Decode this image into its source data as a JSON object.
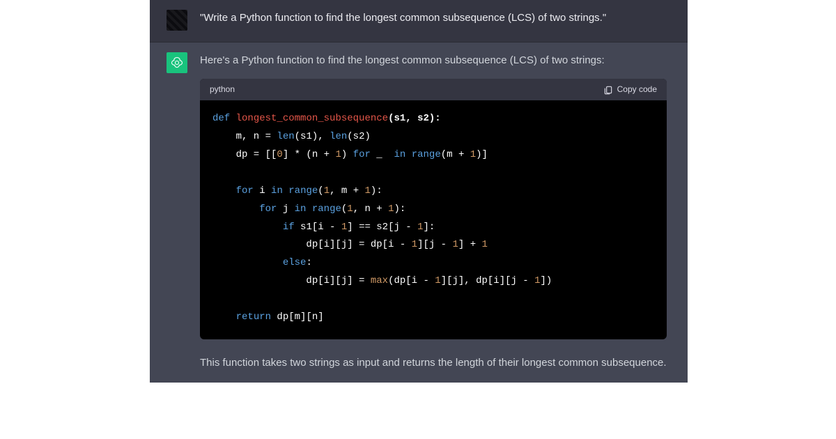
{
  "user_message": "\"Write a Python function to find the longest common subsequence (LCS) of two strings.\"",
  "assistant_intro": "Here's a Python function to find the longest common subsequence (LCS) of two strings:",
  "code_language": "python",
  "copy_label": "Copy code",
  "code_tokens": {
    "l1_def": "def",
    "l1_fn": "longest_common_subsequence",
    "l1_args": "(s1, s2):",
    "l2_a": "    m, n = ",
    "l2_len1": "len",
    "l2_b": "(s1), ",
    "l2_len2": "len",
    "l2_c": "(s2)",
    "l3_a": "    dp = [[",
    "l3_zero": "0",
    "l3_b": "] * (n + ",
    "l3_one": "1",
    "l3_c": ") ",
    "l3_for": "for",
    "l3_d": " _ ",
    "l3_in": " in ",
    "l3_range": "range",
    "l3_e": "(m + ",
    "l3_one2": "1",
    "l3_f": ")]",
    "l5_for": "for",
    "l5_a": " i ",
    "l5_in": "in",
    "l5_b": " ",
    "l5_range": "range",
    "l5_c": "(",
    "l5_one": "1",
    "l5_d": ", m + ",
    "l5_one2": "1",
    "l5_e": "):",
    "l6_for": "for",
    "l6_a": " j ",
    "l6_in": "in",
    "l6_b": " ",
    "l6_range": "range",
    "l6_c": "(",
    "l6_one": "1",
    "l6_d": ", n + ",
    "l6_one2": "1",
    "l6_e": "):",
    "l7_if": "if",
    "l7_a": " s1[i - ",
    "l7_one": "1",
    "l7_b": "] == s2[j - ",
    "l7_one2": "1",
    "l7_c": "]:",
    "l8_a": "                dp[i][j] = dp[i - ",
    "l8_one": "1",
    "l8_b": "][j - ",
    "l8_one2": "1",
    "l8_c": "] + ",
    "l8_one3": "1",
    "l9_else": "else",
    "l9_a": ":",
    "l10_a": "                dp[i][j] = ",
    "l10_max": "max",
    "l10_b": "(dp[i - ",
    "l10_one": "1",
    "l10_c": "][j], dp[i][j - ",
    "l10_one2": "1",
    "l10_d": "])",
    "l12_return": "return",
    "l12_a": " dp[m][n]",
    "pad4": "    ",
    "pad8": "        ",
    "pad12": "            "
  },
  "assistant_post": "This function takes two strings as input and returns the length of their longest common subsequence."
}
